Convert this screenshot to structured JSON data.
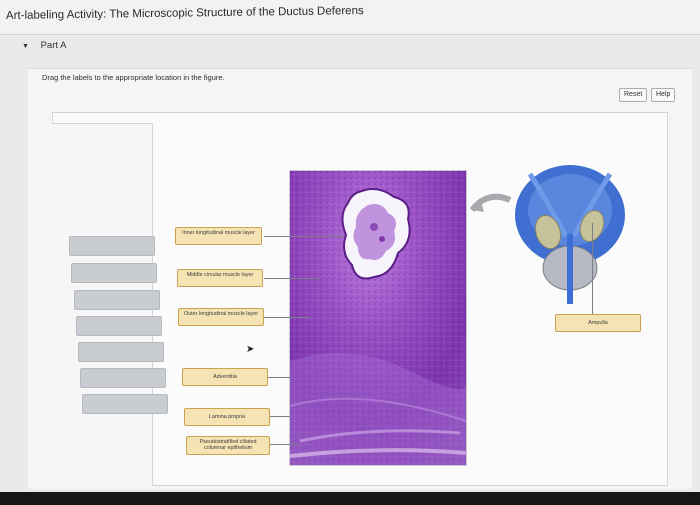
{
  "header": {
    "title": "Art-labeling Activity: The Microscopic Structure of the Ductus Deferens"
  },
  "part": {
    "label": "Part A",
    "caret_icon": "caret-down-icon"
  },
  "instructions": "Drag the labels to the appropriate location in the figure.",
  "buttons": {
    "reset": "Reset",
    "help": "Help"
  },
  "labels": [
    "Inner longitudinal muscle layer",
    "Middle circular muscle layer",
    "Outer longitudinal muscle layer",
    "Adventitia",
    "Lamina propria",
    "Pseudostratified ciliated columnar epithelium",
    "Ampulla"
  ],
  "label_bank": {
    "empty_slots": 7
  },
  "colors": {
    "label_fill": "#f6e3b4",
    "label_border": "#c9a252",
    "slot_fill": "#c9cdd2",
    "stain_purple": "#8d45b5",
    "organ_blue": "#3f6fd0"
  }
}
